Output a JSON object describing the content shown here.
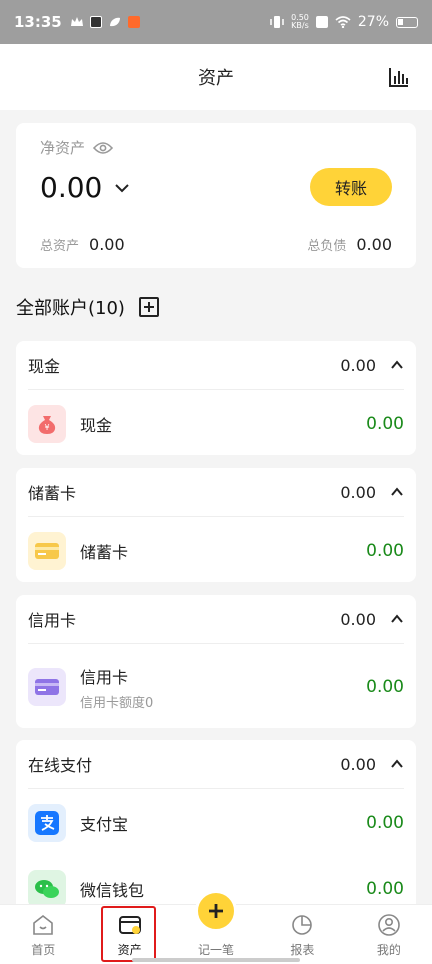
{
  "status_bar": {
    "time": "13:35",
    "speed": "0.50",
    "speed_unit": "KB/s",
    "battery": "27%"
  },
  "header": {
    "title": "资产"
  },
  "net_assets": {
    "label": "净资产",
    "value": "0.00",
    "transfer_label": "转账",
    "total_assets_label": "总资产",
    "total_assets_value": "0.00",
    "total_liabilities_label": "总负债",
    "total_liabilities_value": "0.00"
  },
  "accounts": {
    "header": "全部账户(10)",
    "groups": [
      {
        "name": "现金",
        "total": "0.00",
        "items": [
          {
            "name": "现金",
            "amount": "0.00"
          }
        ]
      },
      {
        "name": "储蓄卡",
        "total": "0.00",
        "items": [
          {
            "name": "储蓄卡",
            "amount": "0.00"
          }
        ]
      },
      {
        "name": "信用卡",
        "total": "0.00",
        "items": [
          {
            "name": "信用卡",
            "sub": "信用卡额度0",
            "amount": "0.00"
          }
        ]
      },
      {
        "name": "在线支付",
        "total": "0.00",
        "items": [
          {
            "name": "支付宝",
            "amount": "0.00"
          },
          {
            "name": "微信钱包",
            "amount": "0.00"
          }
        ]
      }
    ]
  },
  "bottom_nav": {
    "items": [
      {
        "label": "首页"
      },
      {
        "label": "资产"
      },
      {
        "label": "记一笔"
      },
      {
        "label": "报表"
      },
      {
        "label": "我的"
      }
    ]
  },
  "icons": {
    "cash": "money-bag-icon",
    "savings": "debit-card-icon",
    "credit": "credit-card-icon",
    "alipay": "alipay-icon",
    "wechat": "wechat-icon"
  },
  "colors": {
    "accent": "#ffd338",
    "positive": "#1a8a1a",
    "selected_frame": "#e01b1b"
  }
}
